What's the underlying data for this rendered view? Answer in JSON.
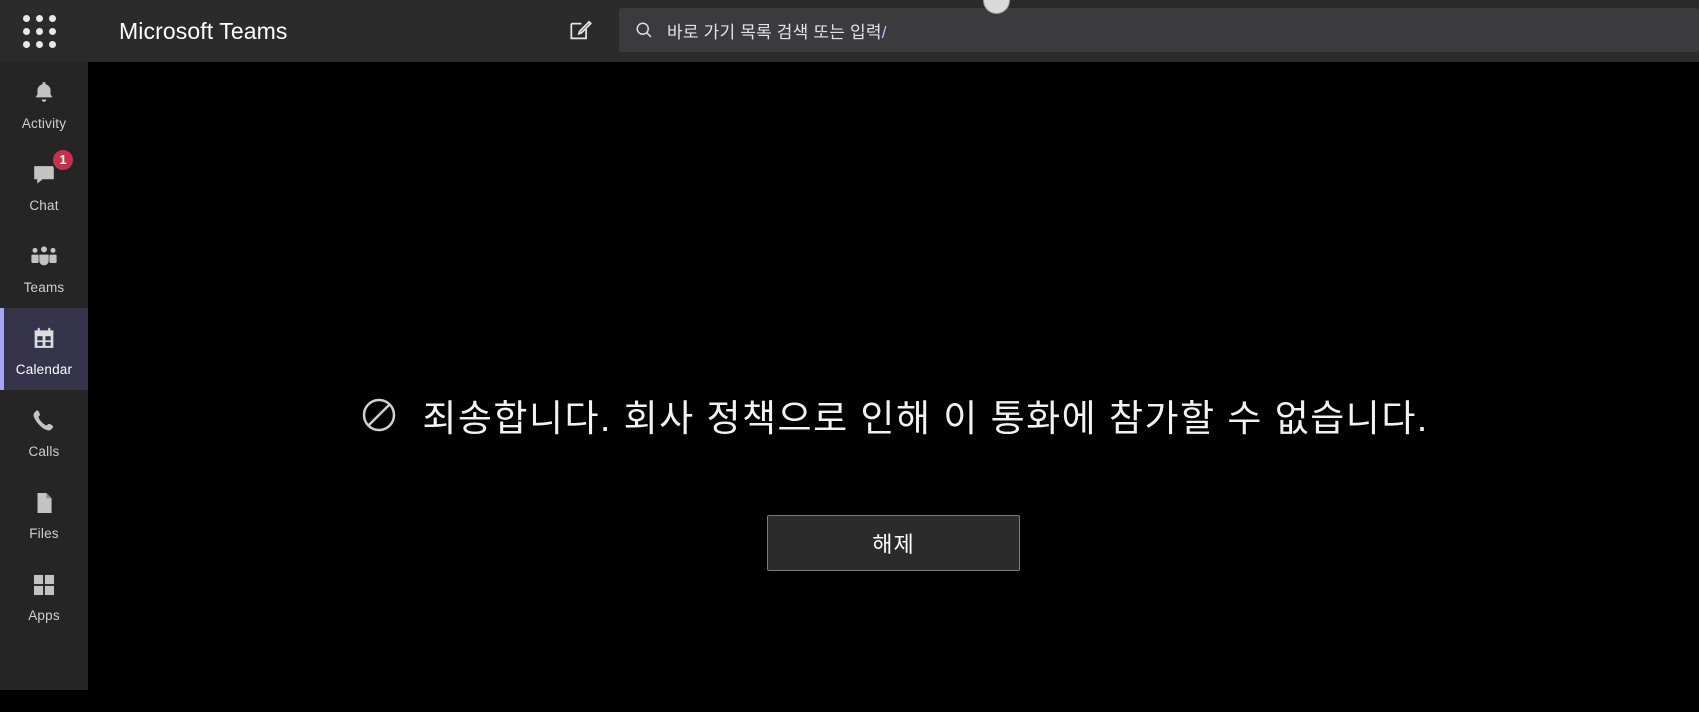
{
  "window": {
    "app_title": "Microsoft Teams"
  },
  "header": {
    "waffle_icon": "app-launcher-icon",
    "compose_icon": "compose-new-icon",
    "search": {
      "icon": "search-icon",
      "placeholder": "바로 가기 목록 검색 또는 입력",
      "caret": "/"
    }
  },
  "sidebar": {
    "items": [
      {
        "label": "Activity",
        "icon": "bell-icon",
        "active": false,
        "badge": null
      },
      {
        "label": "Chat",
        "icon": "chat-bubble-icon",
        "active": false,
        "badge": "1"
      },
      {
        "label": "Teams",
        "icon": "people-icon",
        "active": false,
        "badge": null
      },
      {
        "label": "Calendar",
        "icon": "calendar-icon",
        "active": true,
        "badge": null
      },
      {
        "label": "Calls",
        "icon": "phone-icon",
        "active": false,
        "badge": null
      },
      {
        "label": "Files",
        "icon": "file-icon",
        "active": false,
        "badge": null
      },
      {
        "label": "Apps",
        "icon": "grid-apps-icon",
        "active": false,
        "badge": null
      }
    ]
  },
  "main": {
    "notice": {
      "icon": "prohibited-icon",
      "message": "죄송합니다. 회사 정책으로 인해 이 통화에 참가할 수 없습니다."
    },
    "dismiss_button_label": "해제"
  },
  "colors": {
    "titlebar_bg": "#2b2b2b",
    "rail_bg": "#252525",
    "stage_bg": "#000000",
    "search_bg": "#3b3a3d",
    "active_item_bg": "#35344a",
    "active_accent": "#a6a6f0",
    "badge_bg": "#c4314b",
    "button_bg": "#2b2b2b",
    "button_border": "#7a7a7a",
    "text_primary": "#ffffff"
  }
}
